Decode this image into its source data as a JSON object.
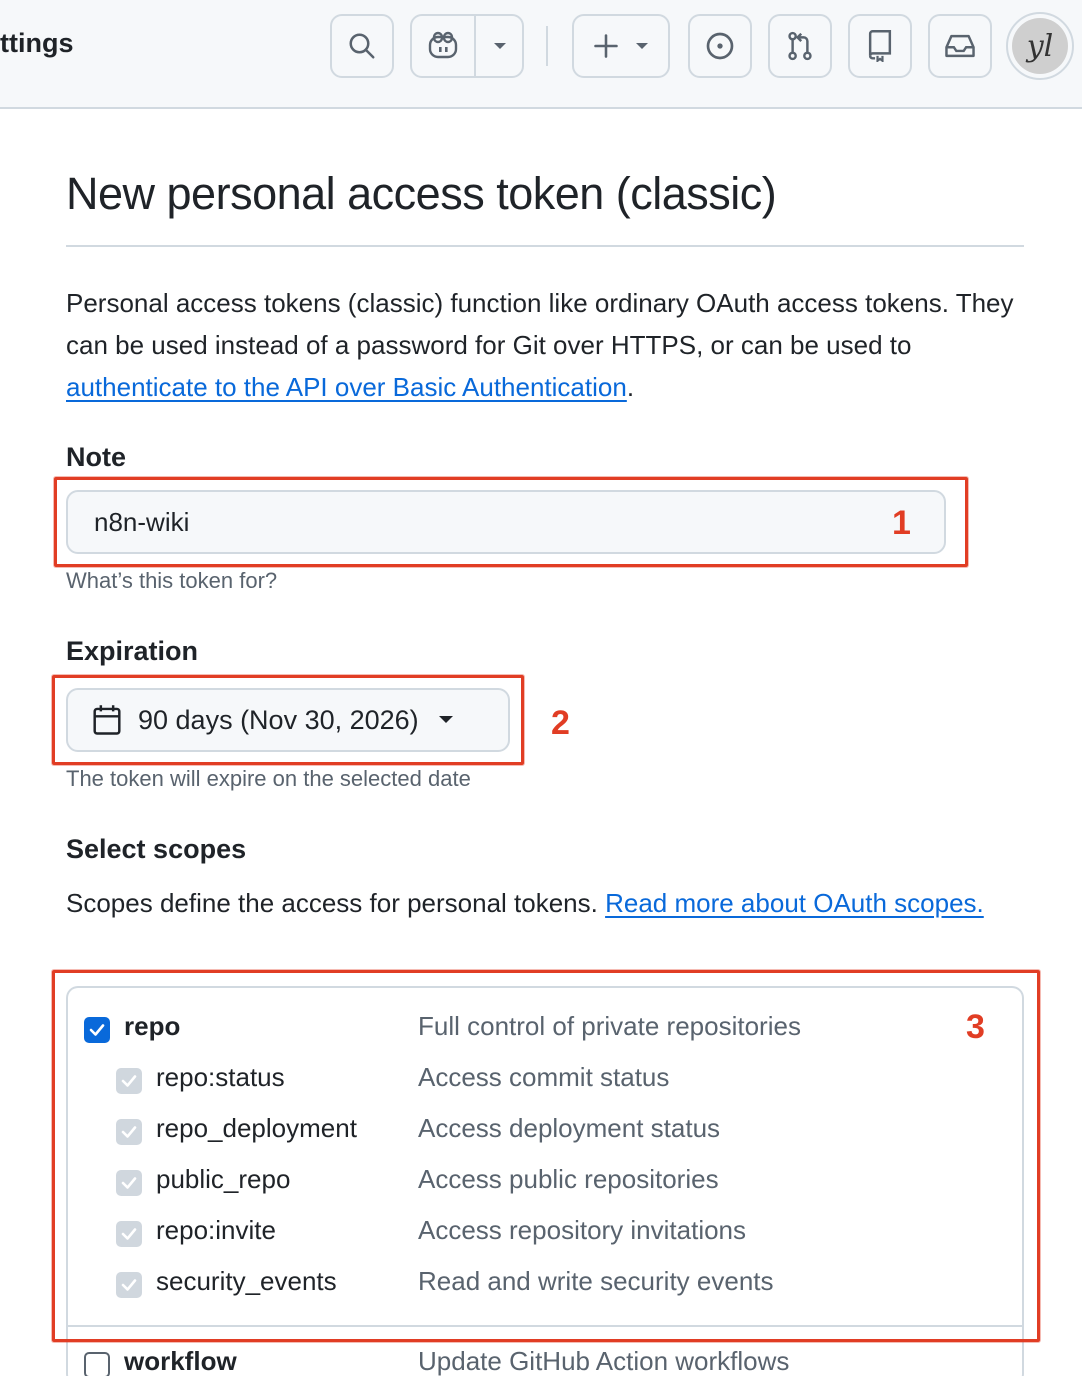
{
  "header": {
    "breadcrumb": "ttings",
    "icons": [
      "search-icon",
      "copilot-icon",
      "chevron-down-icon",
      "plus-icon",
      "issue-icon",
      "pull-request-icon",
      "repo-icon",
      "inbox-icon"
    ],
    "avatar_initials": "yl"
  },
  "page": {
    "title": "New personal access token (classic)",
    "intro_text": "Personal access tokens (classic) function like ordinary OAuth access tokens. They can be used instead of a password for Git over HTTPS, or can be used to ",
    "intro_link": "authenticate to the API over Basic Authentication",
    "intro_end": "."
  },
  "note": {
    "label": "Note",
    "value": "n8n-wiki",
    "hint": "What’s this token for?"
  },
  "expiration": {
    "label": "Expiration",
    "selected": "90 days (Nov 30, 2026)",
    "hint": "The token will expire on the selected date"
  },
  "scopes": {
    "heading": "Select scopes",
    "desc": "Scopes define the access for personal tokens. ",
    "desc_link": "Read more about OAuth scopes.",
    "items": [
      {
        "name": "repo",
        "desc": "Full control of private repositories",
        "state": "checked"
      },
      {
        "name": "repo:status",
        "desc": "Access commit status",
        "state": "disabled"
      },
      {
        "name": "repo_deployment",
        "desc": "Access deployment status",
        "state": "disabled"
      },
      {
        "name": "public_repo",
        "desc": "Access public repositories",
        "state": "disabled"
      },
      {
        "name": "repo:invite",
        "desc": "Access repository invitations",
        "state": "disabled"
      },
      {
        "name": "security_events",
        "desc": "Read and write security events",
        "state": "disabled"
      },
      {
        "name": "workflow",
        "desc": "Update GitHub Action workflows",
        "state": "unchecked"
      }
    ]
  },
  "annotations": [
    "1",
    "2",
    "3"
  ],
  "colors": {
    "accent": "#0969da",
    "annotation": "#e13d24",
    "border": "#d1d9e0"
  }
}
